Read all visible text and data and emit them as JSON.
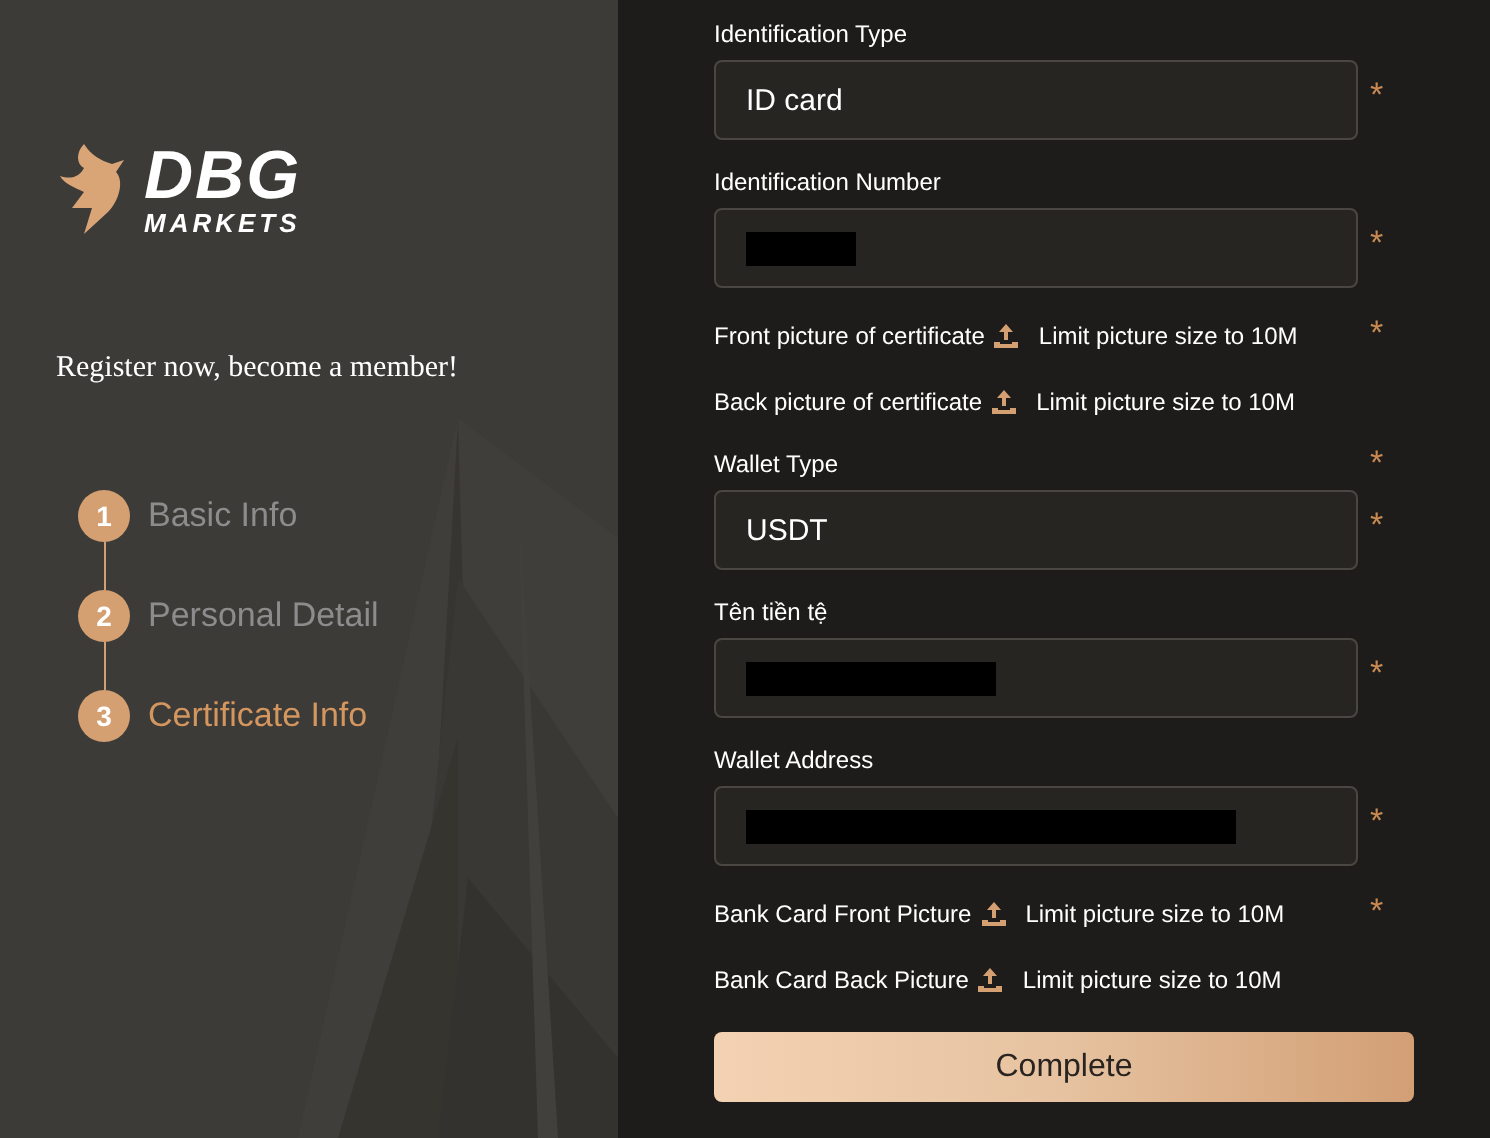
{
  "brand": {
    "name": "DBG",
    "subname": "MARKETS"
  },
  "tagline": "Register now, become a member!",
  "steps": [
    {
      "number": "1",
      "label": "Basic Info",
      "selected": false
    },
    {
      "number": "2",
      "label": "Personal Detail",
      "selected": false
    },
    {
      "number": "3",
      "label": "Certificate Info",
      "selected": true
    }
  ],
  "form": [
    {
      "kind": "input",
      "label": "Identification Type",
      "value": "ID card",
      "required_mark": "*"
    },
    {
      "kind": "input",
      "label": "Identification Number",
      "redacted": true,
      "required_mark": "*"
    },
    {
      "kind": "upload",
      "label": "Front picture of certificate",
      "hint": "Limit picture size to 10M",
      "required_mark": "*"
    },
    {
      "kind": "upload",
      "label": "Back picture of certificate",
      "hint": "Limit picture size to 10M"
    },
    {
      "kind": "input",
      "label": "Wallet Type",
      "value": "USDT",
      "label_mark": "*",
      "required_mark": "*"
    },
    {
      "kind": "input",
      "label": "Tên tiền tệ",
      "redacted": true,
      "required_mark": "*"
    },
    {
      "kind": "input",
      "label": "Wallet Address",
      "redacted": true,
      "required_mark": "*"
    },
    {
      "kind": "upload",
      "label": "Bank Card Front Picture",
      "hint": "Limit picture size to 10M",
      "required_mark": "*"
    },
    {
      "kind": "upload",
      "label": "Bank Card Back Picture",
      "hint": "Limit picture size to 10M"
    }
  ],
  "submit": "Complete"
}
